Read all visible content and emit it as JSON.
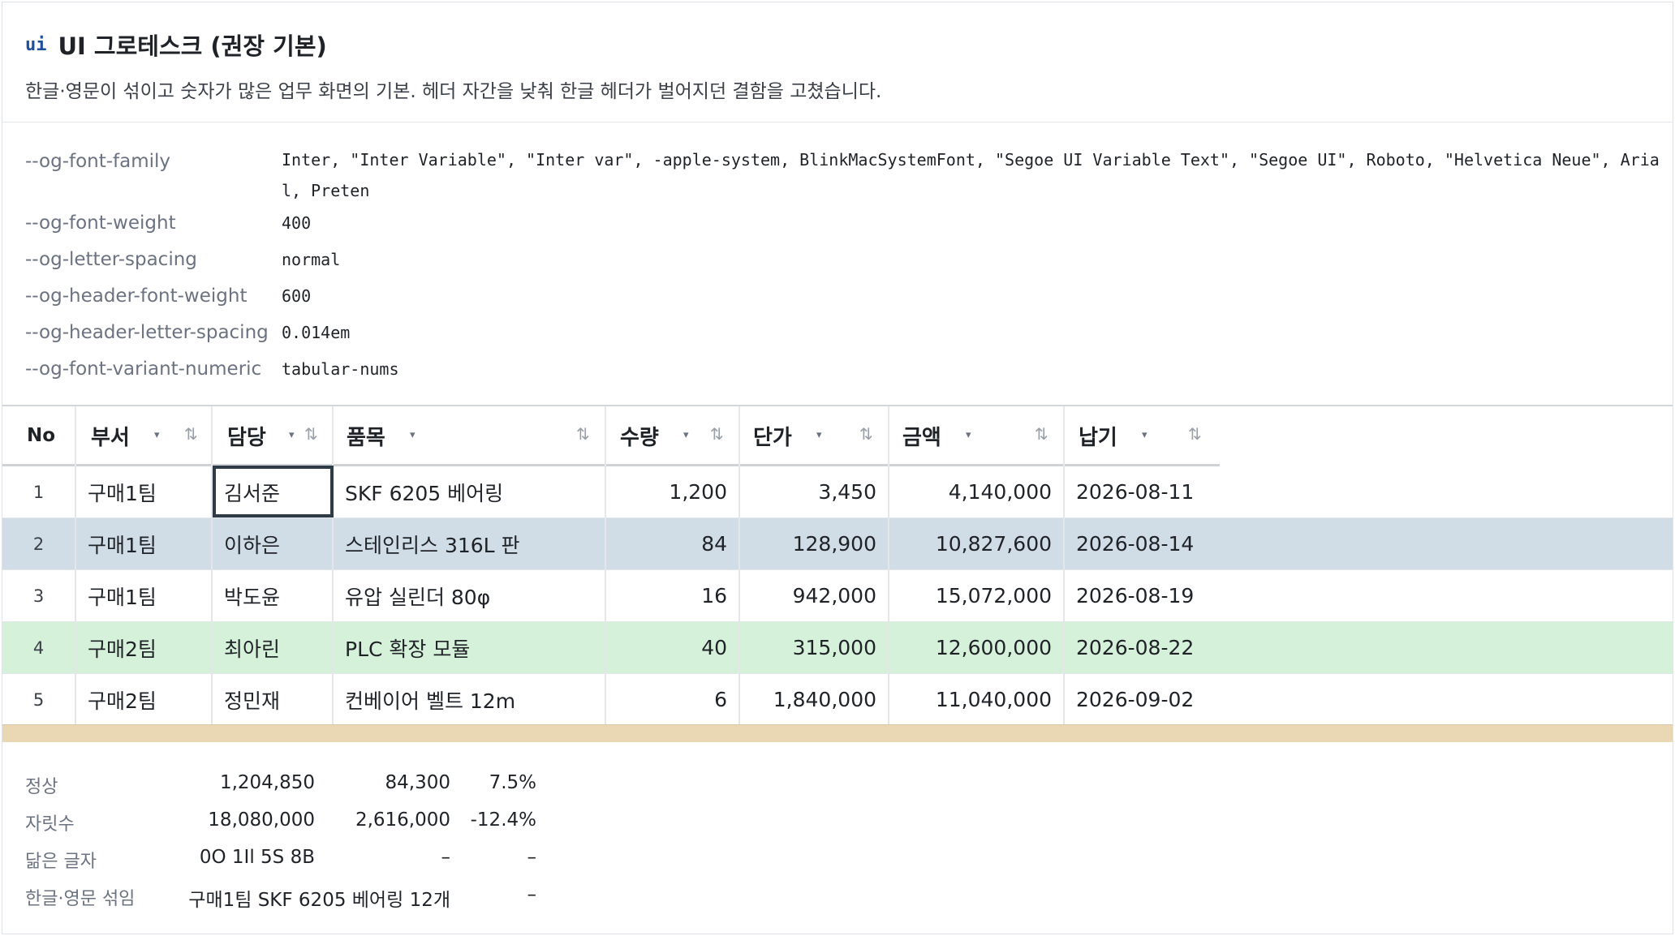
{
  "header": {
    "badge": "ui",
    "title": "UI 그로테스크 (권장 기본)",
    "subtitle": "한글·영문이 섞이고 숫자가 많은 업무 화면의 기본. 헤더 자간을 낮춰 한글 헤더가 벌어지던 결함을 고쳤습니다."
  },
  "variables": [
    {
      "name": "--og-font-family",
      "value": "Inter, \"Inter Variable\", \"Inter var\", -apple-system, BlinkMacSystemFont, \"Segoe UI Variable Text\", \"Segoe UI\", Roboto, \"Helvetica Neue\", Arial, Preten"
    },
    {
      "name": "--og-font-weight",
      "value": "400"
    },
    {
      "name": "--og-letter-spacing",
      "value": "normal"
    },
    {
      "name": "--og-header-font-weight",
      "value": "600"
    },
    {
      "name": "--og-header-letter-spacing",
      "value": "0.014em"
    },
    {
      "name": "--og-font-variant-numeric",
      "value": "tabular-nums"
    }
  ],
  "grid": {
    "columns": [
      "No",
      "부서",
      "담당",
      "품목",
      "수량",
      "단가",
      "금액",
      "납기"
    ],
    "caret_icon": "▾",
    "sort_icon": "⇅",
    "rows": [
      {
        "no": "1",
        "dept": "구매1팀",
        "owner": "김서준",
        "item": "SKF 6205 베어링",
        "qty": "1,200",
        "price": "3,450",
        "amount": "4,140,000",
        "due": "2026-08-11"
      },
      {
        "no": "2",
        "dept": "구매1팀",
        "owner": "이하은",
        "item": "스테인리스 316L 판",
        "qty": "84",
        "price": "128,900",
        "amount": "10,827,600",
        "due": "2026-08-14"
      },
      {
        "no": "3",
        "dept": "구매1팀",
        "owner": "박도윤",
        "item": "유압 실린더 80φ",
        "qty": "16",
        "price": "942,000",
        "amount": "15,072,000",
        "due": "2026-08-19"
      },
      {
        "no": "4",
        "dept": "구매2팀",
        "owner": "최아린",
        "item": "PLC 확장 모듈",
        "qty": "40",
        "price": "315,000",
        "amount": "12,600,000",
        "due": "2026-08-22"
      },
      {
        "no": "5",
        "dept": "구매2팀",
        "owner": "정민재",
        "item": "컨베이어 벨트 12m",
        "qty": "6",
        "price": "1,840,000",
        "amount": "11,040,000",
        "due": "2026-09-02"
      }
    ],
    "colors": {
      "selected_row": "#d0dce6",
      "success_row": "#d6f1d9",
      "band": "#ead8b5"
    }
  },
  "samples": [
    {
      "label": "정상",
      "a": "1,204,850",
      "b": "84,300",
      "c": "7.5%"
    },
    {
      "label": "자릿수",
      "a": "18,080,000",
      "b": "2,616,000",
      "c": "-12.4%"
    },
    {
      "label": "닮은 글자",
      "a": "0O 1Il 5S 8B",
      "b": "–",
      "c": "–"
    },
    {
      "label": "한글·영문 섞임",
      "a": "구매1팀 SKF 6205 베어링 12개",
      "b": "",
      "c": "–"
    }
  ]
}
